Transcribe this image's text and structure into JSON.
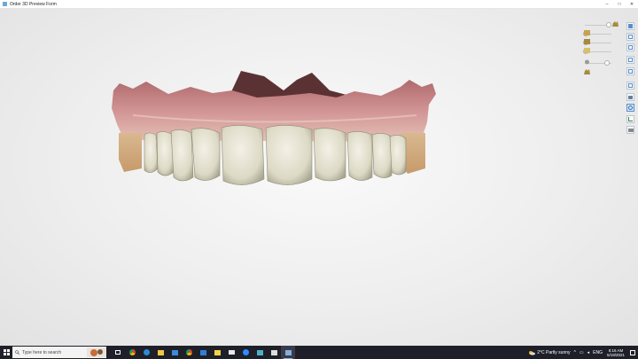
{
  "window": {
    "title": "Order 3D Preview Form",
    "minimize_glyph": "–",
    "maximize_glyph": "□",
    "close_glyph": "✕"
  },
  "viewport": {
    "background": "#ececec",
    "model": "upper-jaw-dentition-with-gingiva"
  },
  "tool_panel": {
    "sliders": [
      {
        "name": "gingiva-opacity",
        "value": 0.85,
        "icon": "jaw-icon"
      },
      {
        "name": "upper-jaw-opacity",
        "value": 0.05,
        "icon": "jaw-icon"
      },
      {
        "name": "teeth-opacity",
        "value": 0.05,
        "icon": "jaw-icon"
      },
      {
        "name": "lower-jaw-opacity",
        "value": 0.05,
        "icon": "jaw-icon"
      },
      {
        "name": "scan-opacity",
        "value": 0.75,
        "icon": "mesh-icon"
      },
      {
        "name": "antagonist-opacity",
        "value": 0.05,
        "icon": "jaw-icon"
      }
    ],
    "tools": [
      "front-view-icon",
      "left-view-icon",
      "right-view-icon",
      "top-view-icon",
      "bottom-view-icon",
      "fit-view-icon",
      "layers-icon",
      "select-icon",
      "measure-icon",
      "snapshot-icon"
    ],
    "active_tool": "select-icon"
  },
  "taskbar": {
    "search_placeholder": "Type here to search",
    "apps": [
      "task-view-icon",
      "chrome-icon",
      "edge-icon",
      "file-explorer-icon",
      "store-icon",
      "chrome-icon",
      "photos-icon",
      "sticky-notes-icon",
      "email-icon",
      "zoom-icon",
      "viewer-icon",
      "explorer-icon",
      "active-app-icon"
    ],
    "weather": "2°C  Partly sunny",
    "language": "ENG",
    "time": "8:16 AM",
    "date": "5/19/2021",
    "accent": "#1f1f2a"
  }
}
